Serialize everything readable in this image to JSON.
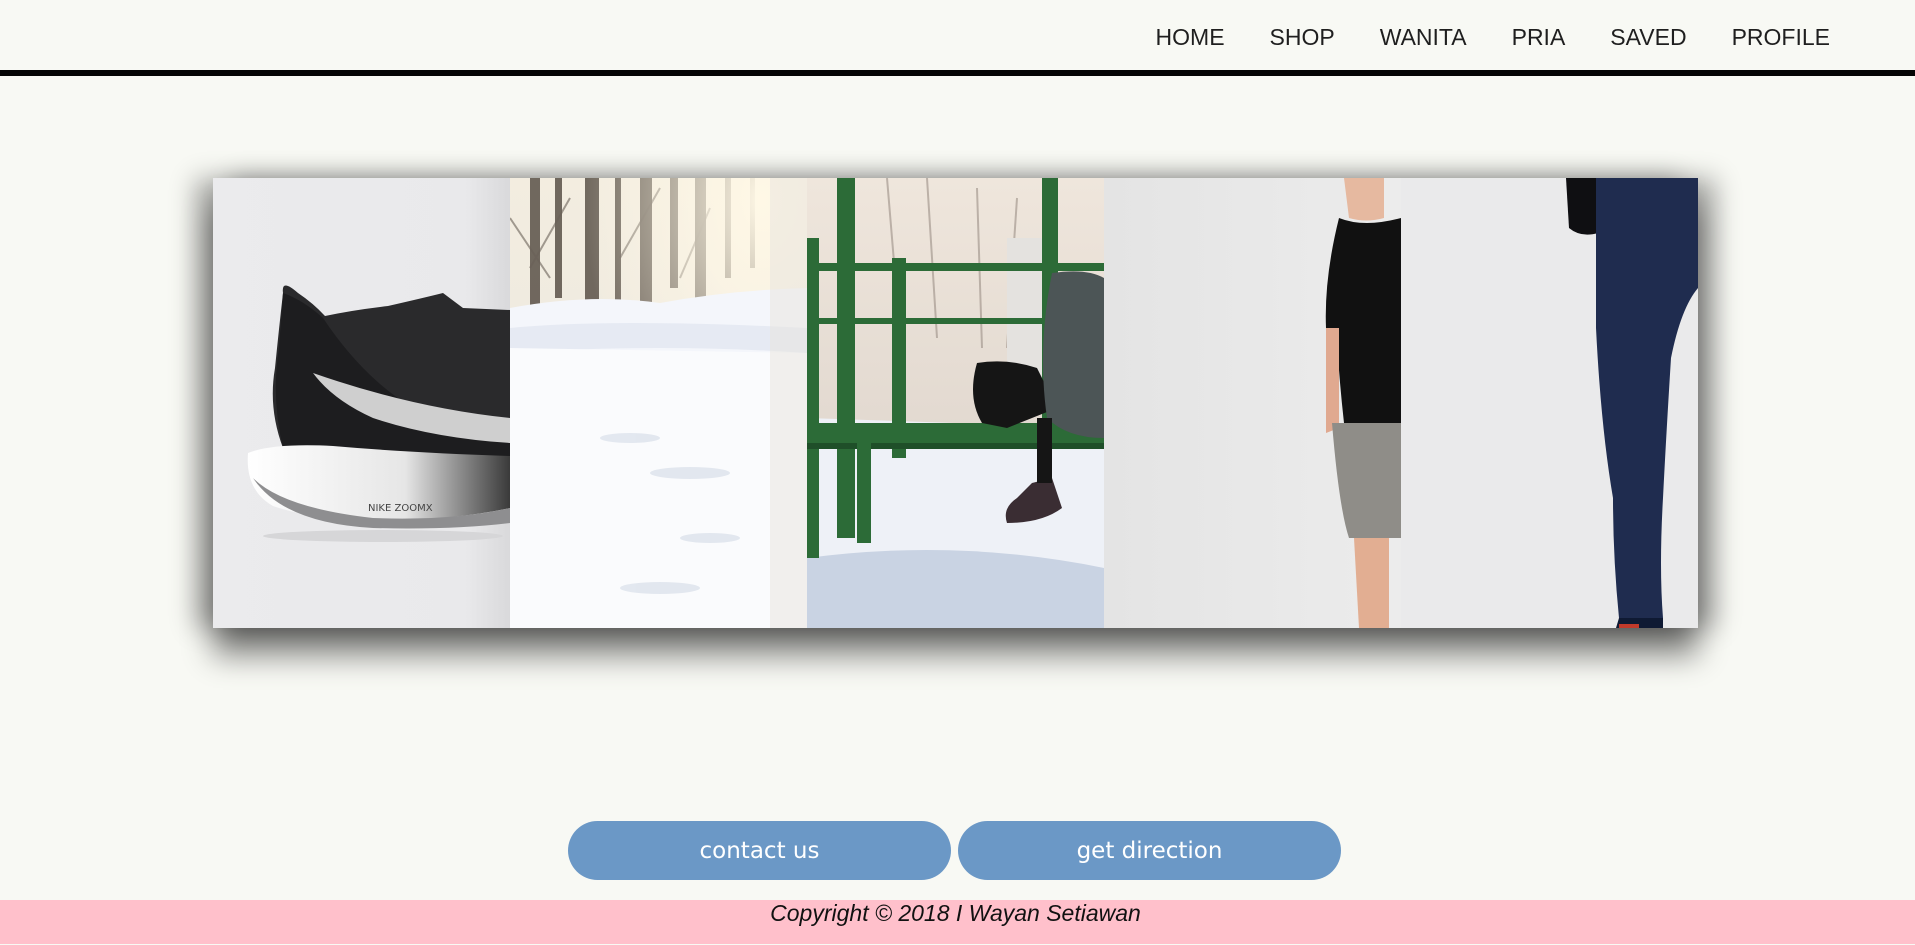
{
  "nav": {
    "items": [
      {
        "label": "HOME"
      },
      {
        "label": "SHOP"
      },
      {
        "label": "WANITA"
      },
      {
        "label": "PRIA"
      },
      {
        "label": "SAVED"
      },
      {
        "label": "PROFILE"
      }
    ]
  },
  "gallery": {
    "panels": [
      {
        "subject": "running shoe",
        "printed_text": "NIKE ZOOMX"
      },
      {
        "subject": "snowy forest path"
      },
      {
        "subject": "person crouching by green bars in snow"
      },
      {
        "subject": "man in black t-shirt and grey shorts"
      },
      {
        "subject": "legs in navy track pants"
      }
    ]
  },
  "buttons": {
    "contact": "contact us",
    "direction": "get direction"
  },
  "footer": {
    "copyright": "Copyright © 2018 I Wayan Setiawan"
  },
  "colors": {
    "background": "#f8f9f4",
    "nav_border": "#050505",
    "button": "#6b98c6",
    "footer": "#ffc0cb"
  }
}
